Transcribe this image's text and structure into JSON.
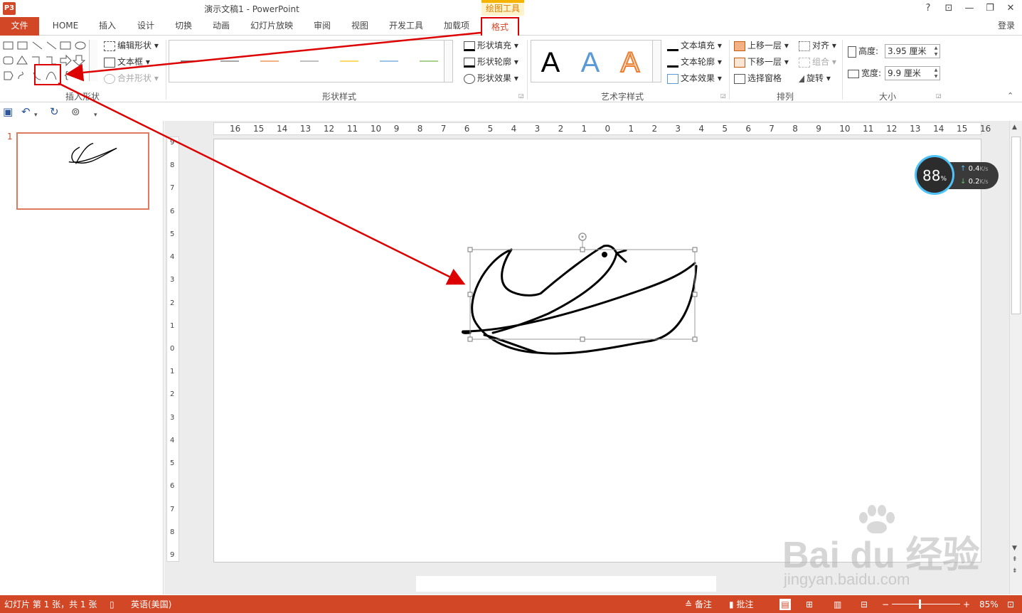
{
  "window": {
    "title": "演示文稿1 - PowerPoint",
    "context_group": "绘图工具",
    "help": "?",
    "restore_ribbon": "⊡",
    "minimize": "—",
    "maximize": "❐",
    "close": "✕",
    "login": "登录"
  },
  "tabs": {
    "file": "文件",
    "home": "HOME",
    "insert": "插入",
    "design": "设计",
    "transitions": "切换",
    "animations": "动画",
    "slideshow": "幻灯片放映",
    "review": "审阅",
    "view": "视图",
    "developer": "开发工具",
    "addins": "加载项",
    "format": "格式"
  },
  "ribbon": {
    "insert_shapes": {
      "label": "插入形状",
      "edit_shape": "编辑形状",
      "text_box": "文本框",
      "merge_shapes": "合并形状"
    },
    "shape_styles": {
      "label": "形状样式",
      "fill": "形状填充",
      "outline": "形状轮廓",
      "effects": "形状效果",
      "line_colors": [
        "#7f7f7f",
        "#a6a6a6",
        "#f4b183",
        "#bfbfbf",
        "#ffd966",
        "#9dc3e6",
        "#a9d18e"
      ]
    },
    "wordart": {
      "label": "艺术字样式",
      "letter": "A",
      "text_fill": "文本填充",
      "text_outline": "文本轮廓",
      "text_effects": "文本效果"
    },
    "arrange": {
      "label": "排列",
      "bring_forward": "上移一层",
      "send_backward": "下移一层",
      "selection_pane": "选择窗格",
      "align": "对齐",
      "group": "组合",
      "rotate": "旋转"
    },
    "size": {
      "label": "大小",
      "height_label": "高度:",
      "height_value": "3.95 厘米",
      "width_label": "宽度:",
      "width_value": "9.9 厘米"
    }
  },
  "thumbs": {
    "slide_number": "1"
  },
  "rulers": {
    "horizontal": [
      "16",
      "15",
      "14",
      "13",
      "12",
      "11",
      "10",
      "9",
      "8",
      "7",
      "6",
      "5",
      "4",
      "3",
      "2",
      "1",
      "0",
      "1",
      "2",
      "3",
      "4",
      "5",
      "6",
      "7",
      "8",
      "9",
      "10",
      "11",
      "12",
      "13",
      "14",
      "15",
      "16"
    ],
    "vertical": [
      "9",
      "8",
      "7",
      "6",
      "5",
      "4",
      "3",
      "2",
      "1",
      "0",
      "1",
      "2",
      "3",
      "4",
      "5",
      "6",
      "7",
      "8",
      "9"
    ]
  },
  "net_widget": {
    "percent": "88",
    "percent_sign": "%",
    "up": "0.4",
    "down": "0.2",
    "unit": "K/s"
  },
  "status": {
    "slide_info": "幻灯片 第 1 张，共 1 张",
    "language": "英语(美国)",
    "notes": "备注",
    "comments": "批注",
    "zoom": "85%"
  },
  "watermark": {
    "brand": "Bai du 经验",
    "url": "jingyan.baidu.com"
  }
}
